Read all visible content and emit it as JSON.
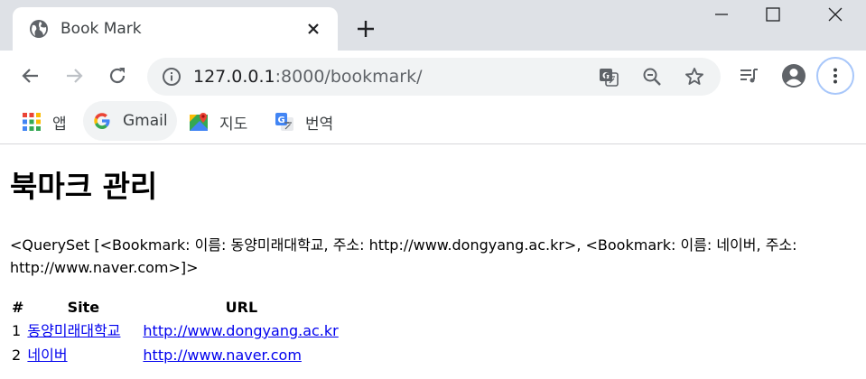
{
  "tab": {
    "title": "Book Mark",
    "favicon": "globe-icon"
  },
  "window_controls": [
    "minimize-icon",
    "maximize-icon",
    "close-icon"
  ],
  "toolbar": {
    "url_host": "127.0.0.1",
    "url_rest": ":8000/bookmark/"
  },
  "bookmarks_bar": {
    "items": [
      {
        "label": "앱",
        "icon": "apps-grid-icon"
      },
      {
        "label": "Gmail",
        "icon": "google-g-icon"
      },
      {
        "label": "지도",
        "icon": "maps-icon"
      },
      {
        "label": "번역",
        "icon": "translate-icon"
      }
    ]
  },
  "page": {
    "heading": "북마크 관리",
    "queryset_text": "<QuerySet [<Bookmark: 이름: 동양미래대학교, 주소: http://www.dongyang.ac.kr>, <Bookmark: 이름: 네이버, 주소: http://www.naver.com>]>",
    "table": {
      "headers": [
        "#",
        "Site",
        "URL"
      ],
      "rows": [
        {
          "num": "1",
          "site": "동양미래대학교",
          "url": "http://www.dongyang.ac.kr"
        },
        {
          "num": "2",
          "site": "네이버",
          "url": "http://www.naver.com"
        }
      ]
    }
  },
  "colors": {
    "chrome_frame": "#dee1e6",
    "omnibox": "#f1f3f4",
    "link": "#0000ee",
    "google_blue": "#4285f4"
  }
}
